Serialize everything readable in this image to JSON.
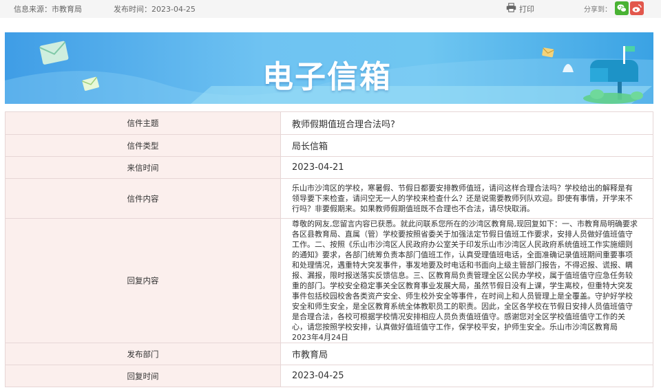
{
  "topbar": {
    "source": "信息来源：市教育局",
    "publish_time": "发布时间：2023-04-25",
    "print_label": "打印",
    "share_label": "分享到："
  },
  "banner": {
    "title": "电子信箱"
  },
  "colors": {
    "label_bg": "#fbefed",
    "border": "#e6d6d6",
    "banner_blue": "#5ab4ee",
    "wechat": "#49b233",
    "weibo": "#e2574c"
  },
  "icons": [
    "printer-icon",
    "wechat-icon",
    "weibo-icon",
    "envelope-icon",
    "mailbox-icon"
  ],
  "letter": {
    "rows": [
      {
        "label": "信件主题",
        "value": "教师假期值班合理合法吗?"
      },
      {
        "label": "信件类型",
        "value": "局长信箱"
      },
      {
        "label": "来信时间",
        "value": "2023-04-21"
      },
      {
        "label": "信件内容",
        "value": "乐山市沙湾区的学校，寒暑假、节假日都要安排教师值班，请问这样合理合法吗？学校给出的解释是有领导要下来检查，请问空无一人的学校来检查什么？还是说需要教师列队欢迎。即使有事情，开学来不行吗？非要假期来。如果教师假期值班既不合理也不合法，请尽快取消。"
      },
      {
        "label": "回复内容",
        "value": "尊敬的网友,您留言内容已获悉。就此问联系您所在的沙湾区教育局,现回复如下：一、市教育局明确要求各区县教育局、直属（管）学校要按照省委关于加强法定节假日值班工作要求，安排人员做好值班值守工作。二、按照《乐山市沙湾区人民政府办公室关于印发乐山市沙湾区人民政府系统值班工作实施细则的通知》要求，各部门统筹负责本部门值班工作，认真受理值班电话，全面准确记录值班期间重要事项和处理情况，遇重特大突发事件，事发地要及时电话和书面向上级主管部门报告，不得迟报、谎报、瞒报、漏报，限时报送落实反馈信息。三、区教育局负责管理全区公民办学校，属于值班值守应急任务较重的部门。学校安全稳定事关全区教育事业发展大局，虽然节假日没有上课，学生离校，但重特大突发事件包括校园校舍各类资产安全、师生校外安全等事件，在时间上和人员管理上是全覆盖。守护好学校安全和师生安全，是全区教育系统全体教职员工的职责。因此，全区各学校在节假日安排人员值班值守是合理合法，各校可根据学校情况安排相应人员负责值班值守。感谢您对全区学校值班值守工作的关心，请您按照学校安排，认真做好值班值守工作，保学校平安，护师生安全。乐山市沙湾区教育局 2023年4月24日"
      },
      {
        "label": "发布部门",
        "value": "市教育局"
      },
      {
        "label": "回复时间",
        "value": "2023-04-25"
      }
    ]
  }
}
